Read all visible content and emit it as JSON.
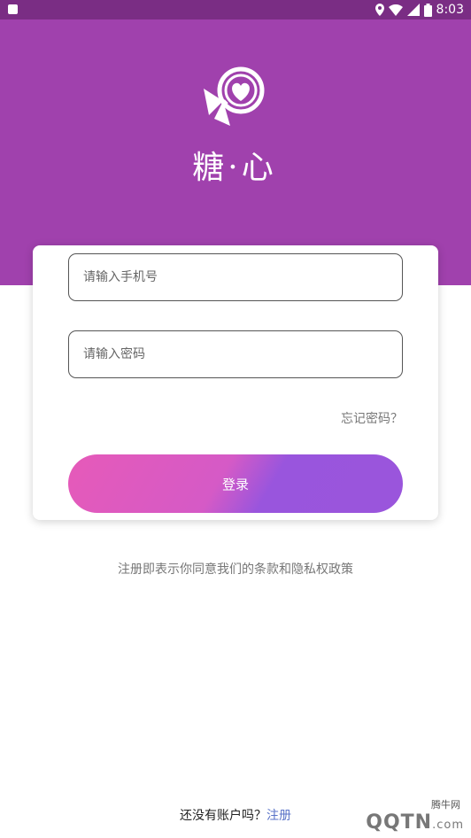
{
  "status_bar": {
    "time": "8:03"
  },
  "brand": {
    "name": "糖·心"
  },
  "form": {
    "phone_placeholder": "请输入手机号",
    "password_placeholder": "请输入密码",
    "forgot_label": "忘记密码？",
    "login_label": "登录"
  },
  "terms": "注册即表示你同意我们的条款和隐私权政策",
  "footer": {
    "prompt": "还没有账户吗？",
    "register_label": "注册"
  },
  "watermark": {
    "top": "腾牛网",
    "main": "QQTN",
    "suffix": ".com"
  },
  "colors": {
    "hero": "#a041ad",
    "status_bar": "#7a2d84",
    "button_start": "#e65ab9",
    "button_end": "#9955dd",
    "link": "#5a73c8"
  }
}
